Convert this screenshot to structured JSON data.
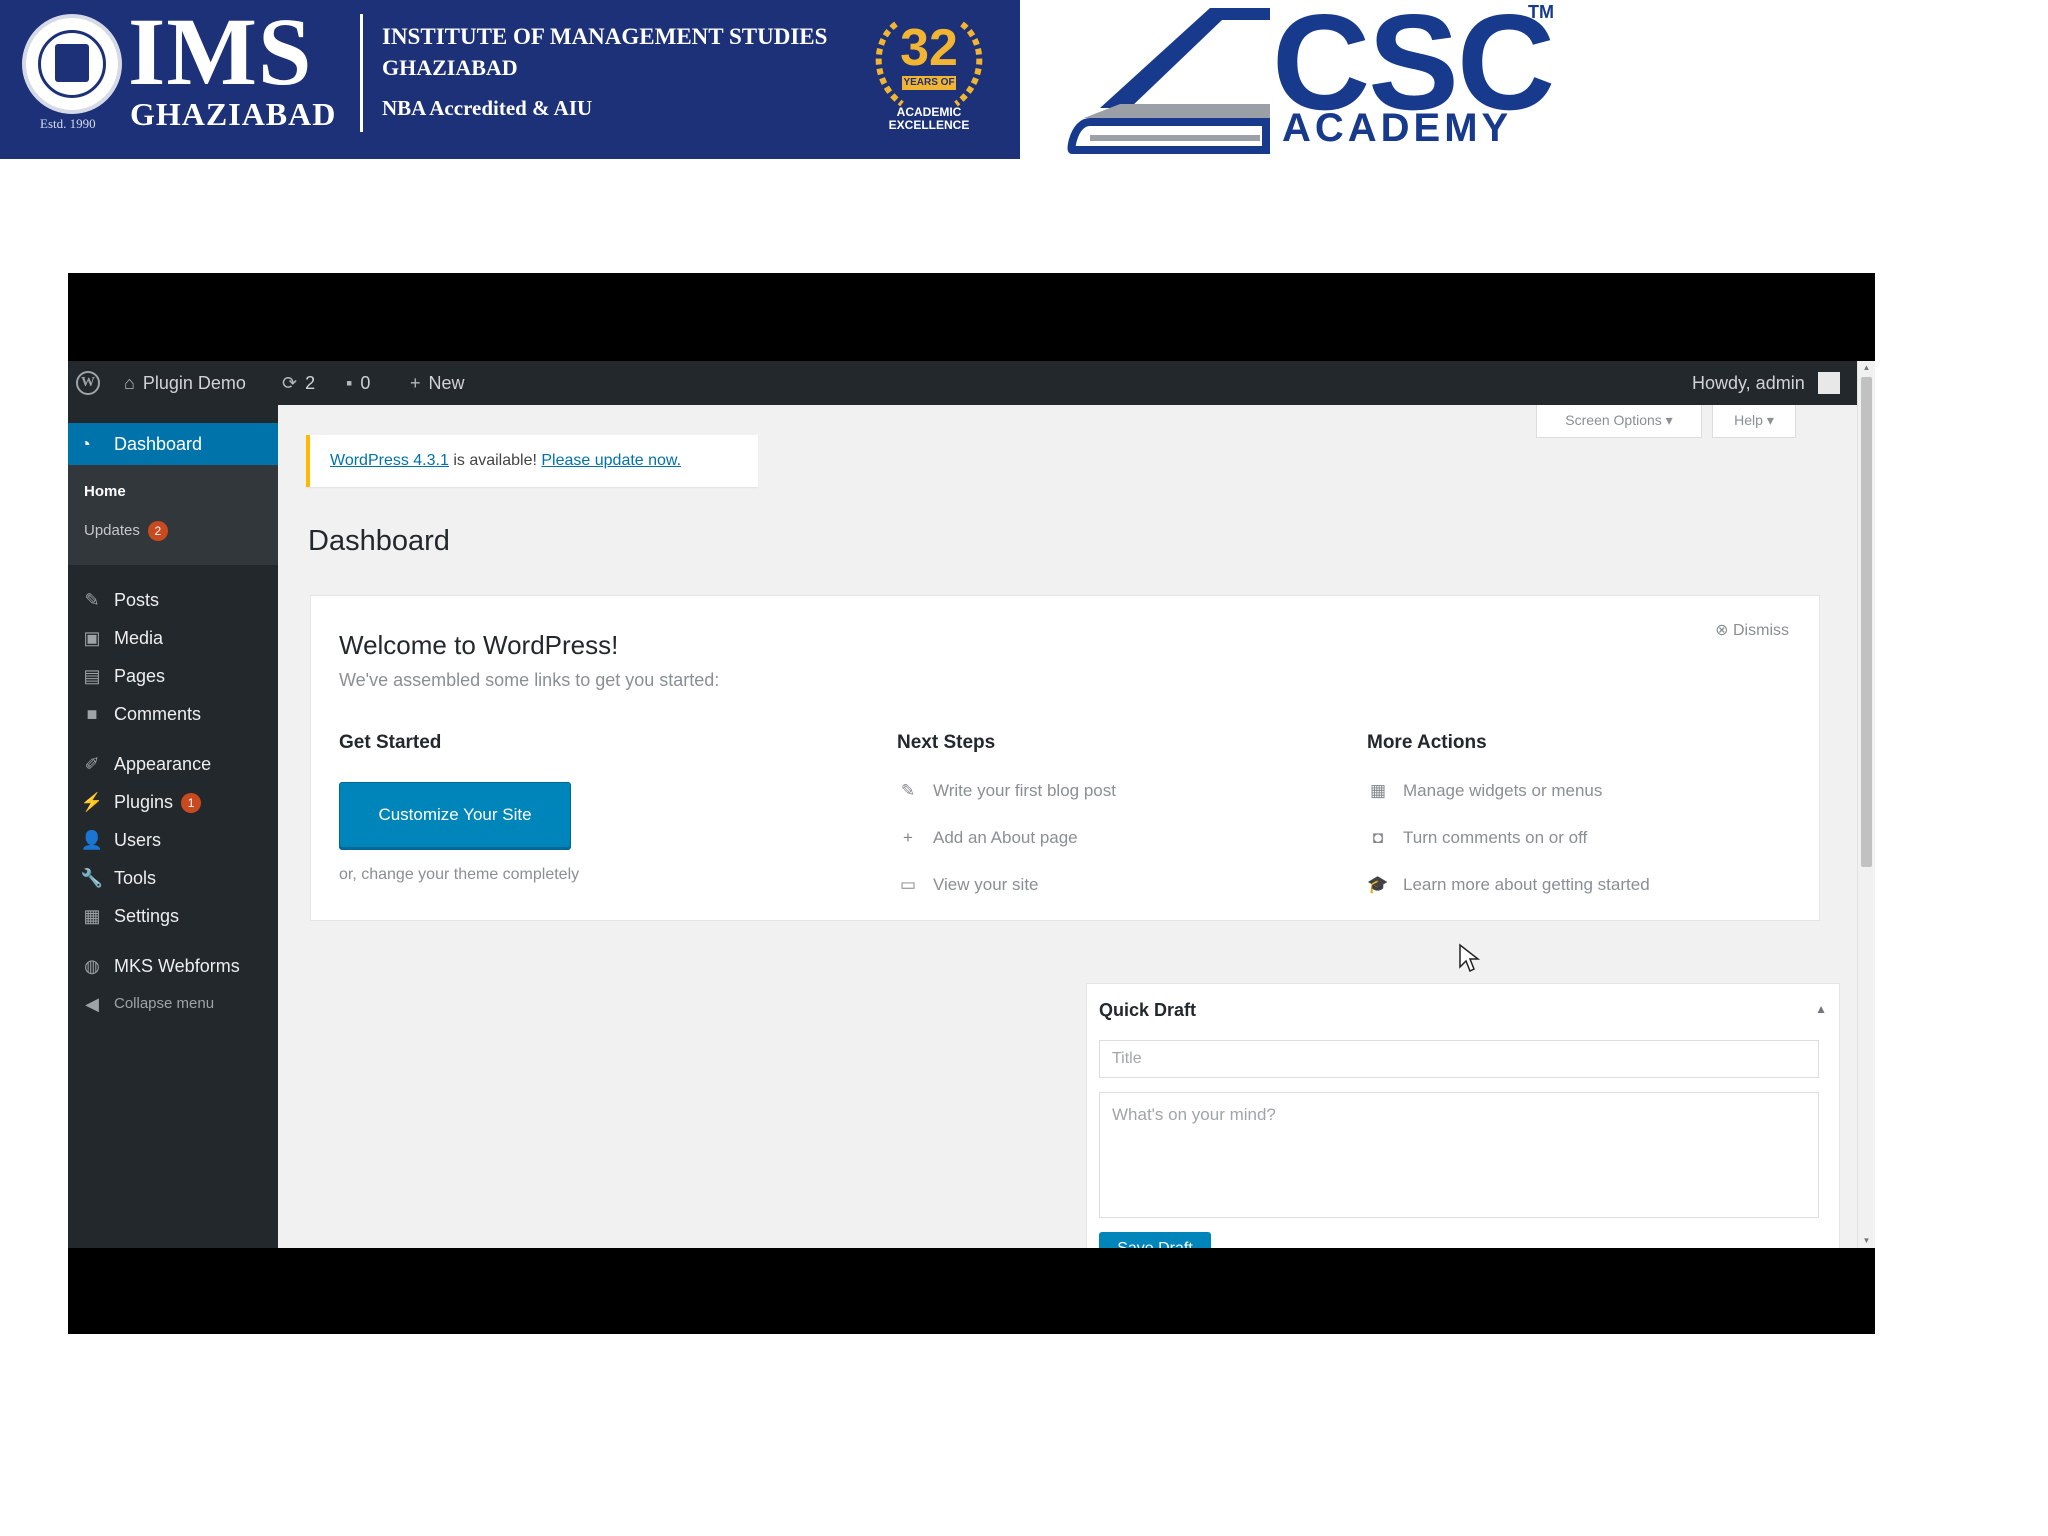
{
  "banner": {
    "ims_logo": "IMS",
    "ims_city": "GHAZIABAD",
    "ims_estd": "Estd. 1990",
    "ims_line1": "INSTITUTE OF MANAGEMENT STUDIES",
    "ims_line2": "GHAZIABAD",
    "ims_line3": "NBA Accredited & AIU",
    "badge_years_number": "32",
    "badge_years_label": "YEARS OF",
    "badge_caption": "ACADEMIC EXCELLENCE",
    "csc_letters": "CSC",
    "csc_tm": "TM",
    "csc_academy": "ACADEMY",
    "colors": {
      "ims_blue": "#1c3177",
      "gold": "#f2b531",
      "csc_blue": "#173a8d"
    }
  },
  "adminbar": {
    "site_name": "Plugin Demo",
    "updates_count": "2",
    "comments_count": "0",
    "new_label": "New",
    "howdy": "Howdy, admin"
  },
  "sidebar": {
    "dashboard": "Dashboard",
    "home": "Home",
    "updates": "Updates",
    "updates_count": "2",
    "items": [
      {
        "label": "Posts",
        "icon": "pin-icon"
      },
      {
        "label": "Media",
        "icon": "media-icon"
      },
      {
        "label": "Pages",
        "icon": "pages-icon"
      },
      {
        "label": "Comments",
        "icon": "comment-icon"
      },
      {
        "label": "Appearance",
        "icon": "brush-icon"
      },
      {
        "label": "Plugins",
        "icon": "plugin-icon",
        "count": "1"
      },
      {
        "label": "Users",
        "icon": "user-icon"
      },
      {
        "label": "Tools",
        "icon": "wrench-icon"
      },
      {
        "label": "Settings",
        "icon": "settings-icon"
      },
      {
        "label": "MKS Webforms",
        "icon": "webforms-icon"
      },
      {
        "label": "Collapse menu",
        "icon": "collapse-icon"
      }
    ],
    "colors": {
      "bg": "#23282d",
      "active": "#0073aa",
      "badge": "#ca4a1f"
    }
  },
  "header": {
    "screen_options": "Screen Options ▾",
    "help": "Help ▾"
  },
  "notice": {
    "version_link": "WordPress 4.3.1",
    "middle_text": " is available! ",
    "update_link": "Please update now."
  },
  "page": {
    "title": "Dashboard"
  },
  "welcome": {
    "dismiss": "Dismiss",
    "title": "Welcome to WordPress!",
    "subtitle": "We've assembled some links to get you started:",
    "get_started": "Get Started",
    "customize_button": "Customize Your Site",
    "change_theme": "or, change your theme completely",
    "next_steps": "Next Steps",
    "next_steps_links": [
      "Write your first blog post",
      "Add an About page",
      "View your site"
    ],
    "more_actions": "More Actions",
    "more_actions_links": [
      "Manage widgets or menus",
      "Turn comments on or off",
      "Learn more about getting started"
    ]
  },
  "quick_draft": {
    "heading": "Quick Draft",
    "title_placeholder": "Title",
    "content_placeholder": "What's on your mind?",
    "save_button": "Save Draft"
  }
}
